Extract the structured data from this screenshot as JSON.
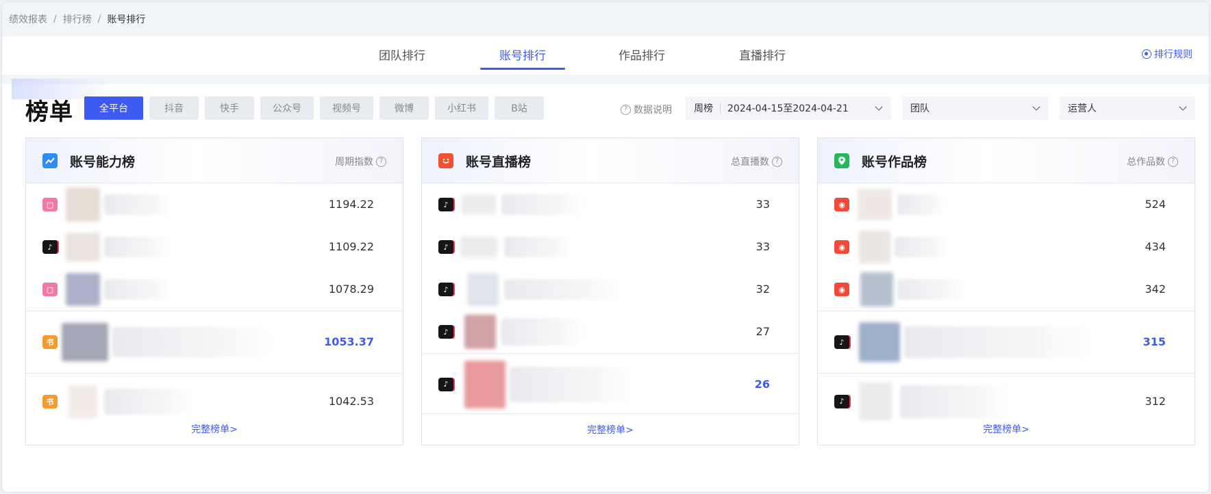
{
  "breadcrumb": {
    "items": [
      "绩效报表",
      "排行榜"
    ],
    "current": "账号排行"
  },
  "tabs": [
    {
      "label": "团队排行",
      "active": false
    },
    {
      "label": "账号排行",
      "active": true
    },
    {
      "label": "作品排行",
      "active": false
    },
    {
      "label": "直播排行",
      "active": false
    }
  ],
  "rules_label": "排行规则",
  "board_title": "榜单",
  "platforms": [
    {
      "label": "全平台",
      "active": true
    },
    {
      "label": "抖音"
    },
    {
      "label": "快手"
    },
    {
      "label": "公众号"
    },
    {
      "label": "视频号"
    },
    {
      "label": "微博"
    },
    {
      "label": "小红书"
    },
    {
      "label": "B站"
    }
  ],
  "data_note": "数据说明",
  "filters": {
    "period_type": "周榜",
    "date_range": "2024-04-15至2024-04-21",
    "team": "团队",
    "operator": "运营人"
  },
  "cards": {
    "ability": {
      "title": "账号能力榜",
      "metric": "周期指数",
      "footer": "完整榜单>",
      "rows": [
        {
          "platform": "bilibili",
          "value": "1194.22"
        },
        {
          "platform": "douyin",
          "value": "1109.22"
        },
        {
          "platform": "bilibili",
          "value": "1078.29"
        },
        {
          "platform": "xiaohongshu",
          "value": "1053.37",
          "highlight": true
        },
        {
          "platform": "xiaohongshu",
          "value": "1042.53"
        }
      ]
    },
    "live": {
      "title": "账号直播榜",
      "metric": "总直播数",
      "footer": "完整榜单>",
      "rows": [
        {
          "platform": "douyin",
          "value": "33"
        },
        {
          "platform": "douyin",
          "value": "33"
        },
        {
          "platform": "douyin",
          "value": "32"
        },
        {
          "platform": "douyin",
          "value": "27"
        },
        {
          "platform": "douyin",
          "value": "26",
          "highlight": true
        }
      ]
    },
    "works": {
      "title": "账号作品榜",
      "metric": "总作品数",
      "footer": "完整榜单>",
      "rows": [
        {
          "platform": "weibo",
          "value": "524"
        },
        {
          "platform": "weibo",
          "value": "434"
        },
        {
          "platform": "weibo",
          "value": "342"
        },
        {
          "platform": "douyin",
          "value": "315",
          "highlight": true
        },
        {
          "platform": "douyin",
          "value": "312"
        }
      ]
    }
  }
}
